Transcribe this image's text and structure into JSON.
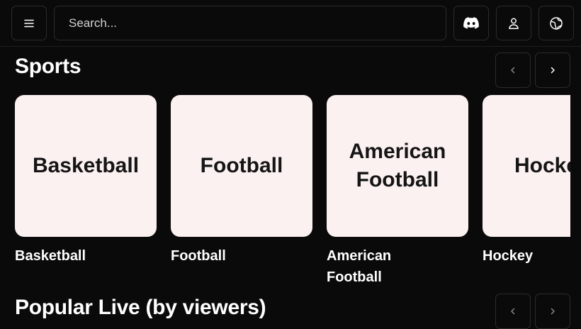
{
  "search": {
    "placeholder": "Search..."
  },
  "header": {
    "menu_icon": "hamburger-menu-icon",
    "discord_icon": "discord-icon",
    "user_icon": "user-icon",
    "globe_icon": "globe-icon"
  },
  "sections": [
    {
      "title": "Sports",
      "items": [
        {
          "tile": "Basketball",
          "caption": "Basketball"
        },
        {
          "tile": "Football",
          "caption": "Football"
        },
        {
          "tile": "American\nFootball",
          "caption": "American Football"
        },
        {
          "tile": "Hockey",
          "caption": "Hockey"
        }
      ]
    },
    {
      "title": "Popular Live (by viewers)"
    }
  ],
  "colors": {
    "background": "#0b0a0a",
    "tile": "#fcf1f1",
    "border": "#2c2a2a"
  }
}
